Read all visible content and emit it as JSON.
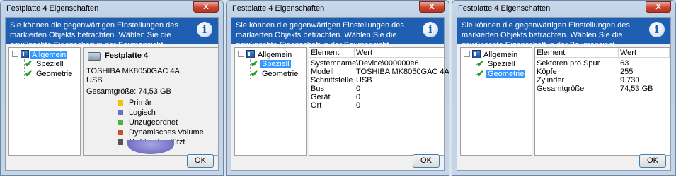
{
  "windows": [
    {
      "title": "Festplatte 4 Eigenschaften",
      "close_label": "X",
      "banner_text": "Sie können die gegenwärtigen Einstellungen des markierten Objekts betrachten. Wählen Sie die gewünschte Eigenschaft in der Baumansicht.",
      "info_icon": "i",
      "tree": {
        "expander": "-",
        "root": "Allgemein",
        "children": [
          "Speziell",
          "Geometrie"
        ],
        "selected": "Allgemein"
      },
      "general": {
        "disk_name": "Festplatte 4",
        "model": "TOSHIBA MK8050GAC 4A",
        "bus": "USB",
        "size": "Gesamtgröße: 74,53 GB",
        "legend": [
          {
            "label": "Primär",
            "color": "#f2c200"
          },
          {
            "label": "Logisch",
            "color": "#6f6cc6"
          },
          {
            "label": "Unzugeordnet",
            "color": "#49b53a"
          },
          {
            "label": "Dynamisches Volume",
            "color": "#c7502f"
          },
          {
            "label": "Nicht unterstützt",
            "color": "#555555"
          }
        ]
      },
      "ok_label": "OK"
    },
    {
      "title": "Festplatte 4 Eigenschaften",
      "close_label": "X",
      "banner_text": "Sie können die gegenwärtigen Einstellungen des markierten Objekts betrachten. Wählen Sie die gewünschte Eigenschaft in der Baumansicht.",
      "info_icon": "i",
      "tree": {
        "expander": "-",
        "root": "Allgemein",
        "children": [
          "Speziell",
          "Geometrie"
        ],
        "selected": "Speziell"
      },
      "table": {
        "headers": [
          "Element",
          "Wert"
        ],
        "rows": [
          [
            "Systemname",
            "\\Device\\000000e6"
          ],
          [
            "Modell",
            "TOSHIBA MK8050GAC 4A"
          ],
          [
            "Schnittstelle",
            "USB"
          ],
          [
            "Bus",
            "0"
          ],
          [
            "Gerät",
            "0"
          ],
          [
            "Ort",
            "0"
          ]
        ]
      },
      "ok_label": "OK"
    },
    {
      "title": "Festplatte 4 Eigenschaften",
      "close_label": "X",
      "banner_text": "Sie können die gegenwärtigen Einstellungen des markierten Objekts betrachten. Wählen Sie die gewünschte Eigenschaft in der Baumansicht.",
      "info_icon": "i",
      "tree": {
        "expander": "-",
        "root": "Allgemein",
        "children": [
          "Speziell",
          "Geometrie"
        ],
        "selected": "Geometrie"
      },
      "table": {
        "headers": [
          "Element",
          "Wert"
        ],
        "rows": [
          [
            "Sektoren pro Spur",
            "63"
          ],
          [
            "Köpfe",
            "255"
          ],
          [
            "Zylinder",
            "9.730"
          ],
          [
            "Gesamtgröße",
            "74,53 GB"
          ]
        ]
      },
      "ok_label": "OK"
    }
  ],
  "icons": {
    "disk": "hard-drive-icon",
    "check": "check-icon",
    "info": "info-icon",
    "close": "close-icon"
  }
}
